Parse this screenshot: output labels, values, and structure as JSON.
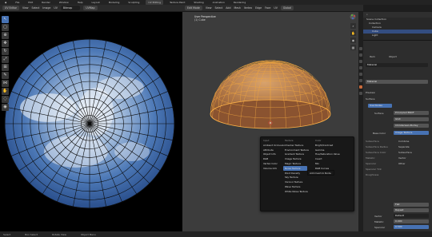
{
  "topbar": {
    "menus": [
      "File",
      "Edit",
      "Render",
      "Window",
      "Help"
    ],
    "workspaces": [
      "Layout",
      "Modeling",
      "Sculpting",
      "UV Editing",
      "Texture Paint",
      "Shading",
      "Animation",
      "Rendering"
    ]
  },
  "uv_header": {
    "mode": "UV Editor",
    "menus": [
      "View",
      "Select",
      "Image",
      "UV"
    ],
    "image_name": "Bitmap",
    "view_pill": "UVMap"
  },
  "uv_tools": [
    "cursor-icon",
    "select-box-icon",
    "cursor-cross-icon",
    "move-icon",
    "rotate-icon",
    "scale-icon",
    "transform-icon",
    "annotate-icon",
    "rip-icon",
    "grab-icon",
    "relax-icon",
    "pinch-icon"
  ],
  "viewport_header": {
    "mode": "Edit Mode",
    "menus": [
      "View",
      "Select",
      "Add",
      "Mesh",
      "Vertex",
      "Edge",
      "Face",
      "UV"
    ],
    "transform": "Global"
  },
  "viewport": {
    "title": "User Perspective",
    "subtitle": "(1) Cube"
  },
  "add_menu": {
    "col1": [
      "Input",
      "Ambient Occlusion",
      "Attribute",
      "Object Info",
      "RGB",
      "Vertex Color",
      "Volume Info"
    ],
    "col2": [
      "Texture",
      "Checker Texture",
      "Environment Texture",
      "Gradient Texture",
      "Image Texture",
      "Magic Texture",
      "Noise Texture",
      "Point Density",
      "Sky Texture",
      "Voronoi Texture",
      "Wave Texture",
      "White Noise Texture"
    ],
    "col3": [
      "Color",
      "Bright/Contrast",
      "Gamma",
      "Hue/Saturation Value",
      "Invert",
      "Mix",
      "RGB Curves"
    ],
    "highlighted": "Image Texture",
    "submenu": "Add mesh to Node"
  },
  "outliner": {
    "title": "Scene Collection",
    "items": [
      "Collection",
      "Camera",
      "Cube",
      "Light"
    ]
  },
  "properties": {
    "tabs": [
      "Item",
      "Object"
    ],
    "material_name": "Material",
    "section_preview": "Preview",
    "section_surface": "Surface",
    "use_nodes": "Use Nodes",
    "surface_label": "Surface",
    "surface_value": "Principled BSDF",
    "distribution": "GGX",
    "subsurface_method": "Christensen-Burley",
    "base_color_label": "Base Color",
    "base_color_value": "Image Texture",
    "fields": [
      "Subsurface",
      "Subsurface Radius",
      "Subsurface Color",
      "Metallic",
      "Specular",
      "Specular Tint",
      "Roughness"
    ],
    "col_b": [
      "Combine",
      "Separate",
      "Subsurface",
      "Vector",
      "Other"
    ],
    "lower_labels": [
      "Flat",
      "Repeat",
      "Vector",
      "Metallic",
      "Specular"
    ],
    "lower_values": [
      "Flat",
      "Repeat",
      "Default",
      "0.000",
      "0.500"
    ]
  },
  "statusbar": {
    "items": [
      "Select",
      "Box Select",
      "Rotate View",
      "Object Menu"
    ]
  }
}
